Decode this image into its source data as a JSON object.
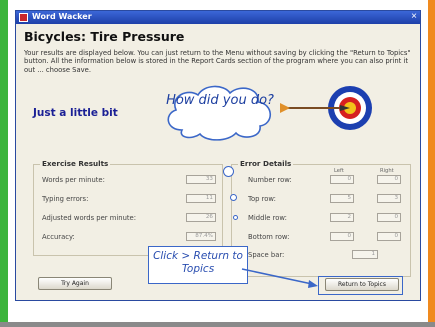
{
  "window": {
    "title": "Word Wacker",
    "close_glyph": "×"
  },
  "page": {
    "title": "Bicycles: Tire Pressure",
    "intro": "Your results are displayed below. You can just return to the Menu without saving by clicking the \"Return to Topics\" button. All the information below is stored in the Report Cards section of the program where you can also print it out ... choose Save.",
    "message": "Just a little bit"
  },
  "exercise_results": {
    "title": "Exercise Results",
    "rows": [
      {
        "label": "Words per minute:",
        "value": "33"
      },
      {
        "label": "Typing errors:",
        "value": "11"
      },
      {
        "label": "Adjusted words per minute:",
        "value": "26"
      },
      {
        "label": "Accuracy:",
        "value": "87.4%"
      }
    ]
  },
  "error_details": {
    "title": "Error Details",
    "col_left": "Left",
    "col_right": "Right",
    "rows": [
      {
        "label": "Number row:",
        "left": "0",
        "right": "0"
      },
      {
        "label": "Top row:",
        "left": "5",
        "right": "3"
      },
      {
        "label": "Middle row:",
        "left": "2",
        "right": "0"
      },
      {
        "label": "Bottom row:",
        "left": "0",
        "right": "0"
      }
    ],
    "space_label": "Space bar:",
    "space_value": "1"
  },
  "buttons": {
    "try_again": "Try Again",
    "return": "Return to Topics"
  },
  "overlays": {
    "cloud": "How did you do?",
    "callout": "Click > Return to Topics"
  },
  "colors": {
    "left_bar": "#3cb43c",
    "right_bar": "#f08a1e",
    "accent": "#3b67c8"
  }
}
